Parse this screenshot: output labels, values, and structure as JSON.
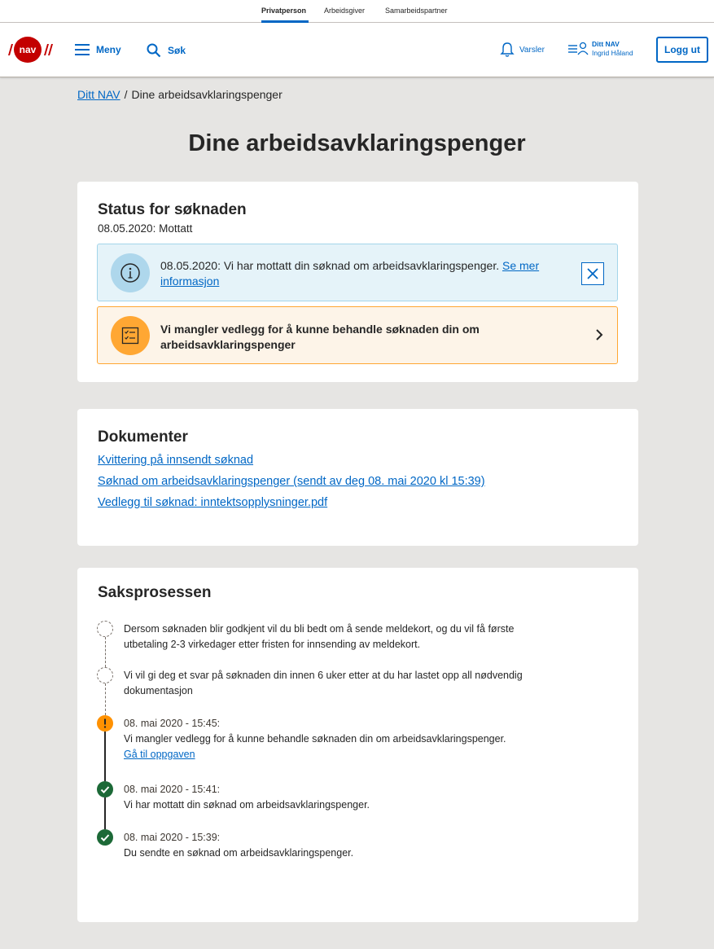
{
  "context_tabs": [
    "Privatperson",
    "Arbeidsgiver",
    "Samarbeidspartner"
  ],
  "header": {
    "menu_label": "Meny",
    "search_label": "Søk",
    "notifications_label": "Varsler",
    "ditt_nav_label": "Ditt NAV",
    "user_name": "Ingrid Håland",
    "logout_label": "Logg ut"
  },
  "breadcrumb": {
    "home": "Ditt NAV",
    "separator": "/",
    "current": "Dine arbeidsavklaringspenger"
  },
  "page_title": "Dine arbeidsavklaringspenger",
  "status": {
    "heading": "Status for søknaden",
    "subtitle": "08.05.2020: Mottatt",
    "info_text": "08.05.2020: Vi har mottatt din søknad om arbeidsavklaringspenger.",
    "info_link": "Se mer informasjon",
    "warning_text": "Vi mangler vedlegg for å kunne behandle søknaden din om arbeidsavklaringspenger"
  },
  "documents": {
    "heading": "Dokumenter",
    "links": [
      "Kvittering på innsendt søknad",
      "Søknad om arbeidsavklaringspenger (sendt av deg 08. mai 2020 kl 15:39)",
      "Vedlegg til søknad: inntektsopplysninger.pdf"
    ]
  },
  "process": {
    "heading": "Saksprosessen",
    "steps": [
      {
        "status": "pending",
        "text": "Dersom søknaden blir godkjent vil du bli bedt om å sende meldekort, og du vil få første utbetaling 2-3 virkedager etter fristen for innsending av meldekort."
      },
      {
        "status": "pending",
        "text": "Vi vil gi deg et svar på søknaden din innen 6 uker etter at du har lastet opp all nødvendig dokumentasjon"
      },
      {
        "status": "warning",
        "date": "08. mai 2020 - 15:45:",
        "text": "Vi mangler vedlegg for å kunne behandle søknaden din om arbeidsavklaringspenger.",
        "link": "Gå til oppgaven"
      },
      {
        "status": "done",
        "date": "08. mai 2020 - 15:41:",
        "text": "Vi har mottatt din søknad om arbeidsavklaringspenger."
      },
      {
        "status": "done",
        "date": "08. mai 2020 - 15:39:",
        "text": "Du sendte en søknad om arbeidsavklaringspenger."
      }
    ]
  },
  "colors": {
    "accent": "#0067c5",
    "brand_red": "#c30000",
    "warning": "#ffa733",
    "info_bg": "#e5f3f9",
    "success": "#1c6937"
  }
}
